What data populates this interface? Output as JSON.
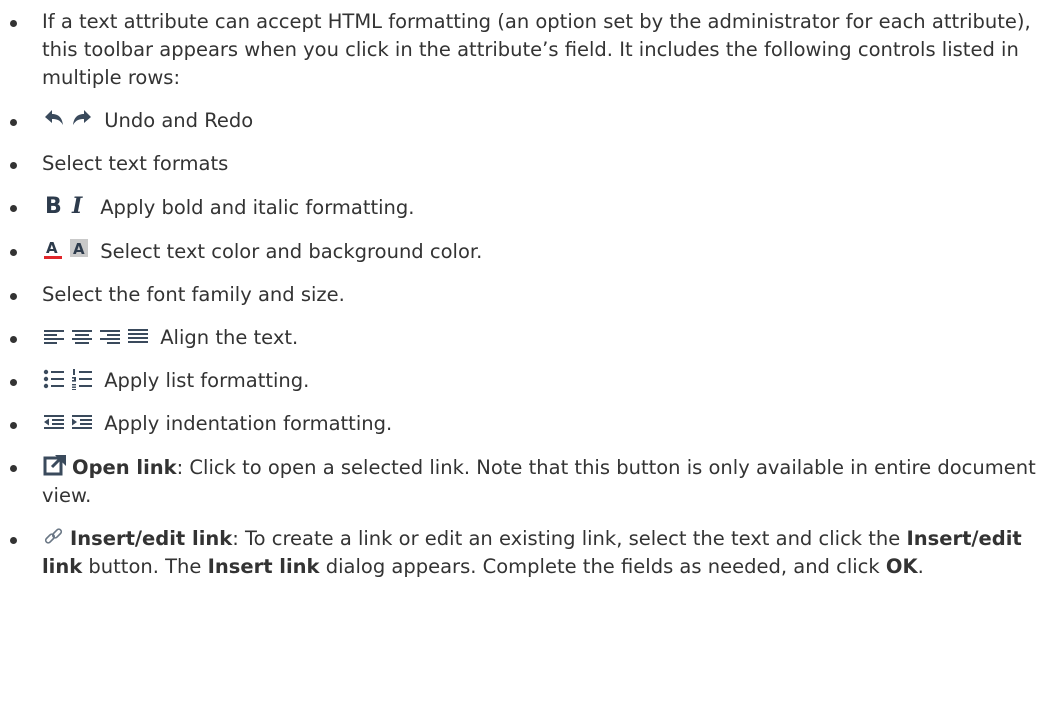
{
  "items": [
    {
      "text": "If a text attribute can accept HTML formatting (an option set by the administrator for each attribute), this toolbar appears when you click in the attribute’s field. It includes the following controls listed in multiple rows:"
    },
    {
      "icons": [
        "undo-icon",
        "redo-icon"
      ],
      "text": "Undo and Redo"
    },
    {
      "text": "Select text formats"
    },
    {
      "icons": [
        "bold-icon",
        "italic-icon"
      ],
      "text": "Apply bold and italic formatting."
    },
    {
      "icons": [
        "text-color-icon",
        "background-color-icon"
      ],
      "text": "Select text color and background color."
    },
    {
      "text": "Select the font family and size."
    },
    {
      "icons": [
        "align-left-icon",
        "align-center-icon",
        "align-right-icon",
        "align-justify-icon"
      ],
      "text": "Align the text."
    },
    {
      "icons": [
        "bullet-list-icon",
        "numbered-list-icon"
      ],
      "text": "Apply list formatting."
    },
    {
      "icons": [
        "outdent-icon",
        "indent-icon"
      ],
      "text": "Apply indentation formatting."
    },
    {
      "icons": [
        "open-link-icon"
      ],
      "label": "Open link",
      "text": ": Click to open a selected link. Note that this button is only available in entire document view."
    },
    {
      "icons": [
        "insert-link-icon"
      ],
      "label": "Insert/edit link",
      "text_a": ": To create a link or edit an existing link, select the text and click the ",
      "bold_b": "Insert/edit link",
      "text_b": " button. The ",
      "bold_c": "Insert link",
      "text_c": " dialog appears. Complete the fields as needed, and click ",
      "bold_d": "OK",
      "text_d": "."
    }
  ],
  "colors": {
    "text": "#333333",
    "text_color_underline": "#e0262b",
    "icon_dark": "#3a4a5c"
  }
}
